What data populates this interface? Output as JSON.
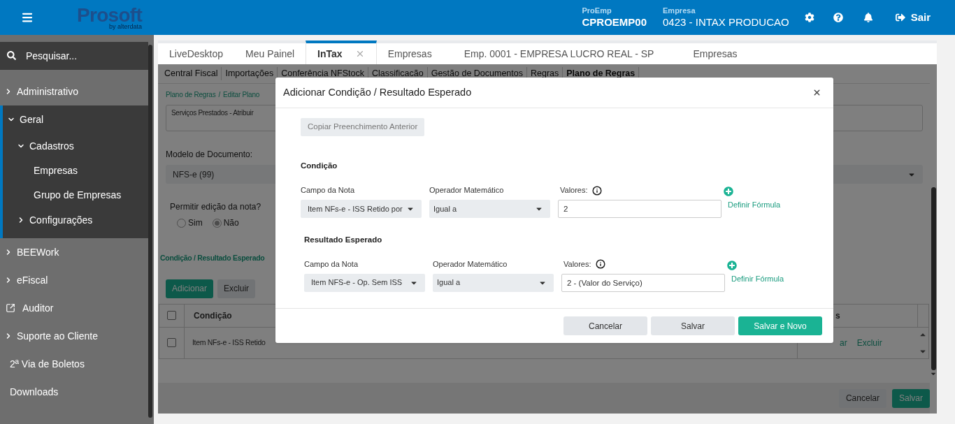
{
  "header": {
    "logo": "Prosoft",
    "logo_tagline": "by alterdata",
    "proemp": {
      "label": "ProEmp",
      "value": "CPROEMP00"
    },
    "empresa": {
      "label": "Empresa",
      "value": "0423 - INTAX PRODUCAO"
    },
    "logout": "Sair"
  },
  "sidebar": {
    "search_placeholder": "Pesquisar...",
    "items": [
      {
        "label": "Administrativo",
        "kind": "group",
        "expanded": false
      },
      {
        "label": "Geral",
        "kind": "group",
        "expanded": true,
        "children": [
          {
            "label": "Cadastros",
            "kind": "group",
            "expanded": true,
            "children": [
              {
                "label": "Empresas",
                "kind": "plain"
              },
              {
                "label": "Grupo de Empresas",
                "kind": "plain"
              }
            ]
          },
          {
            "label": "Configurações",
            "kind": "group",
            "expanded": false
          }
        ]
      },
      {
        "label": "BEEWork",
        "kind": "group",
        "expanded": false
      },
      {
        "label": "eFiscal",
        "kind": "group",
        "expanded": false
      },
      {
        "label": "Auditor",
        "kind": "external"
      },
      {
        "label": "Suporte ao Cliente",
        "kind": "group",
        "expanded": false
      },
      {
        "label": "2ª Via de Boletos",
        "kind": "plain"
      },
      {
        "label": "Downloads",
        "kind": "plain"
      }
    ]
  },
  "tabs": [
    {
      "label": "LiveDesktop",
      "selected": false,
      "closable": false
    },
    {
      "label": "Meu Painel",
      "selected": false,
      "closable": false
    },
    {
      "label": "InTax",
      "selected": true,
      "closable": true
    },
    {
      "label": "Empresas",
      "selected": false,
      "closable": false
    },
    {
      "label": "Emp. 0001 - EMPRESA LUCRO REAL - SP",
      "selected": false,
      "closable": false
    },
    {
      "label": "Empresas",
      "selected": false,
      "closable": false
    }
  ],
  "subtabs": [
    {
      "label": "Central Fiscal",
      "selected": false
    },
    {
      "label": "Importações",
      "selected": false
    },
    {
      "label": "Conferência NFStock",
      "selected": false
    },
    {
      "label": "Classificacão",
      "selected": false
    },
    {
      "label": "Gestão de Documentos",
      "selected": false
    },
    {
      "label": "Regras",
      "selected": false
    },
    {
      "label": "Plano de Regras",
      "selected": true
    }
  ],
  "page": {
    "breadcrumb": [
      "Plano de Regras",
      "Editar Plano"
    ],
    "breadcrumb_separator": "/",
    "description": "Serviços Prestados - Atribuir",
    "model_label": "Modelo de Documento:",
    "model_value": "NFS-e (99)",
    "edit_label": "Permitir edição da nota?",
    "radios": [
      {
        "label": "Sim",
        "selected": false
      },
      {
        "label": "Não",
        "selected": true
      }
    ],
    "section_title": "Condição / Resultado Esperado",
    "buttons": [
      {
        "label": "Adicionar",
        "kind": "primary"
      },
      {
        "label": "Excluir",
        "kind": "secondary"
      }
    ],
    "table": {
      "header": {
        "checked": false,
        "columns": [
          "Condição",
          "s"
        ]
      },
      "rows": [
        {
          "checked": false,
          "cells": [
            "Item NFs-e - ISS Retido"
          ],
          "actions": [
            "ar",
            "Excluir"
          ]
        }
      ]
    },
    "footer_buttons": [
      {
        "label": "Cancelar",
        "kind": "secondary"
      },
      {
        "label": "Salvar",
        "kind": "primary"
      }
    ]
  },
  "modal": {
    "title": "Adicionar Condição / Resultado Esperado",
    "copy_button": "Copiar Preenchimento Anterior",
    "sections": [
      {
        "title": "Condição",
        "field_label": "Campo da Nota",
        "field_value": "Item NFs-e - ISS Retido por",
        "operator_label": "Operador Matemático",
        "operator_value": "Igual a",
        "values_label": "Valores:",
        "values_value": "2",
        "formula_link": "Definir Fórmula"
      },
      {
        "title": "Resultado Esperado",
        "field_label": "Campo da Nota",
        "field_value": "Item NFS-e - Op. Sem ISS",
        "operator_label": "Operador Matemático",
        "operator_value": "Igual a",
        "values_label": "Valores:",
        "values_value": "2 - (Valor do Serviço)",
        "formula_link": "Definir Fórmula"
      }
    ],
    "buttons": [
      {
        "label": "Cancelar",
        "kind": "secondary"
      },
      {
        "label": "Salvar",
        "kind": "secondary"
      },
      {
        "label": "Salvar e Novo",
        "kind": "primary"
      }
    ]
  }
}
